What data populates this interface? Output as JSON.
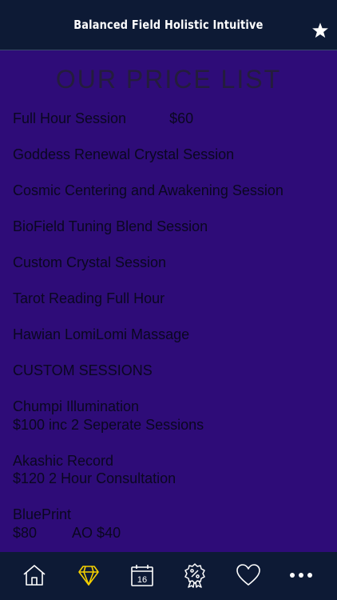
{
  "header": {
    "title": "Balanced Field Holistic Intuitive"
  },
  "page": {
    "title": "OUR PRICE LIST"
  },
  "prices": [
    {
      "lines": [
        "Full Hour Session"
      ],
      "price": "$60"
    },
    {
      "lines": [
        "Goddess Renewal Crystal Session"
      ]
    },
    {
      "lines": [
        "Cosmic Centering and Awakening Session"
      ]
    },
    {
      "lines": [
        "BioField Tuning Blend Session"
      ]
    },
    {
      "lines": [
        "Custom Crystal Session"
      ]
    },
    {
      "lines": [
        "Tarot Reading Full Hour"
      ]
    },
    {
      "lines": [
        "Hawian LomiLomi Massage"
      ]
    },
    {
      "lines": [
        "CUSTOM SESSIONS"
      ]
    },
    {
      "lines": [
        "Chumpi Illumination",
        "$100 inc 2 Seperate Sessions"
      ]
    },
    {
      "lines": [
        "Akashic Record",
        "$120 2 Hour Consultation"
      ]
    },
    {
      "lines": [
        "BluePrint",
        "$80         AO $40"
      ]
    }
  ],
  "tabs": [
    {
      "name": "home-icon",
      "active": false
    },
    {
      "name": "gem-icon",
      "active": true
    },
    {
      "name": "calendar-icon",
      "active": false,
      "label": "16"
    },
    {
      "name": "discount-badge-icon",
      "active": false
    },
    {
      "name": "heart-icon",
      "active": false
    },
    {
      "name": "more-icon",
      "active": false
    }
  ],
  "colors": {
    "header_bg": "#0d1a35",
    "content_bg": "#2e0c78",
    "active_tab": "#f5d000",
    "inactive_tab": "#ffffff"
  }
}
